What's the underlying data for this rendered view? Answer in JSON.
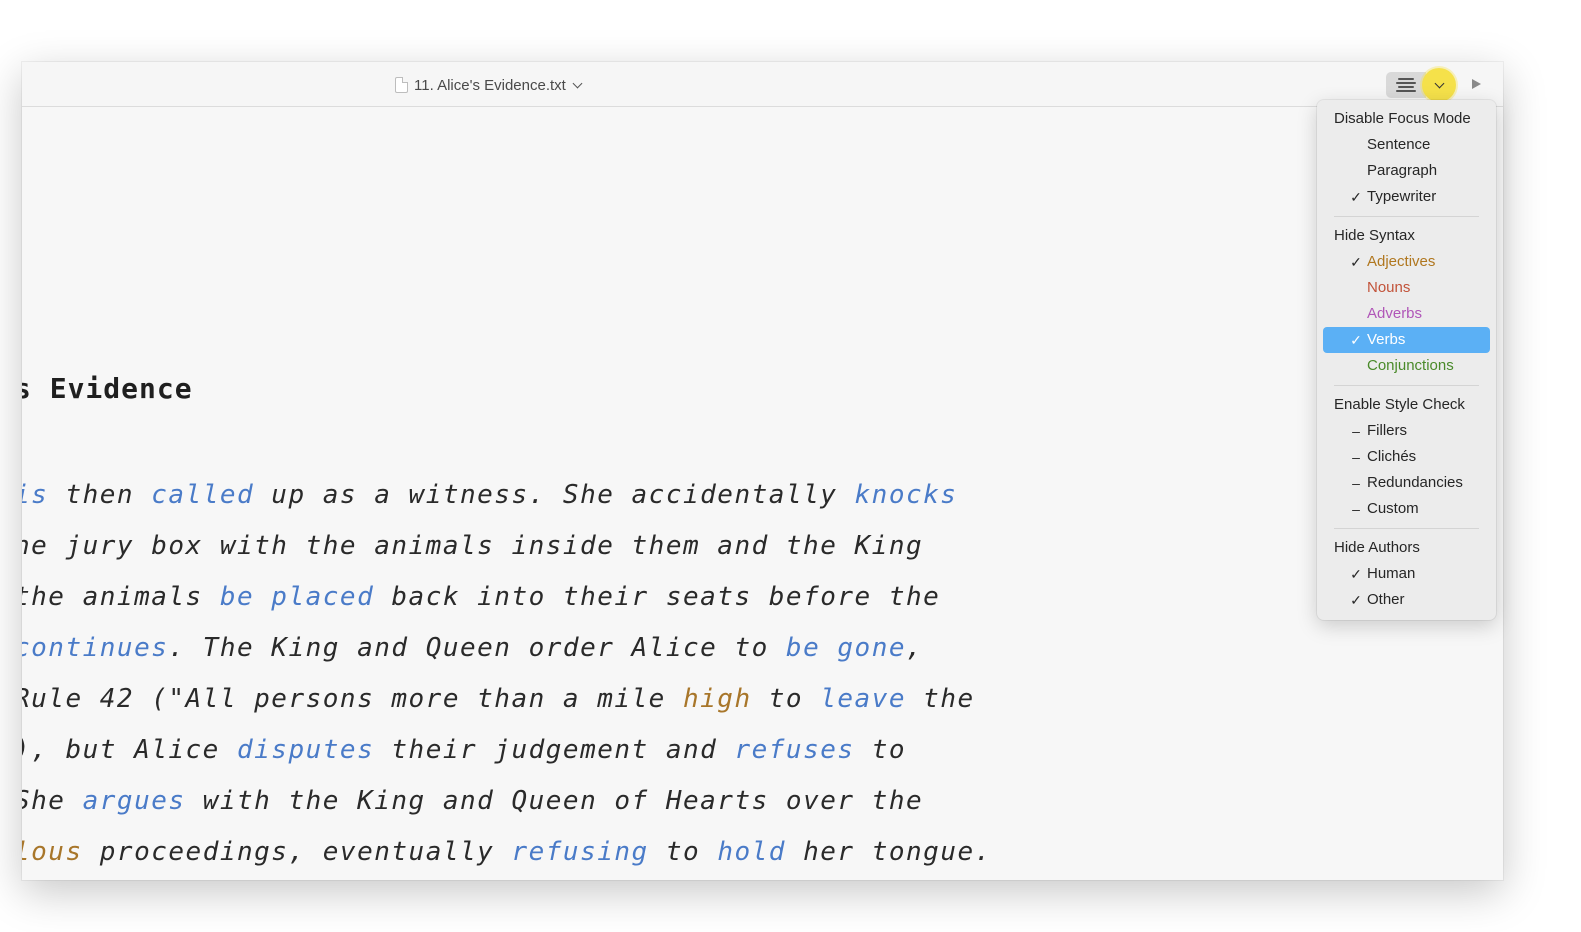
{
  "window": {
    "document_title": "11. Alice's Evidence.txt",
    "icons": {
      "document": "document-icon",
      "focus_mode": "focus-mode-lines-icon",
      "dropdown": "chevron-down-icon",
      "preview": "play-icon"
    },
    "highlight_color": "#f5e14a"
  },
  "editor": {
    "heading": "s Evidence",
    "lines": [
      [
        {
          "t": "is",
          "c": "verb"
        },
        {
          "t": " then "
        },
        {
          "t": "called",
          "c": "verb"
        },
        {
          "t": " up as a witness. She accidentally "
        },
        {
          "t": "knocks",
          "c": "verb"
        }
      ],
      [
        {
          "t": "he jury box with the animals inside them and the King"
        }
      ],
      [
        {
          "t": " the animals "
        },
        {
          "t": "be placed",
          "c": "verb"
        },
        {
          "t": " back into their seats before the"
        }
      ],
      [
        {
          "t": "continues",
          "c": "verb"
        },
        {
          "t": ". The King and Queen order Alice to "
        },
        {
          "t": "be gone",
          "c": "verb"
        },
        {
          "t": ","
        }
      ],
      [
        {
          "t": " Rule 42 (\"All persons more than a mile "
        },
        {
          "t": "high",
          "c": "adj"
        },
        {
          "t": " to "
        },
        {
          "t": "leave",
          "c": "verb"
        },
        {
          "t": " the"
        }
      ],
      [
        {
          "t": "), but Alice "
        },
        {
          "t": "disputes",
          "c": "verb"
        },
        {
          "t": " their judgement and "
        },
        {
          "t": "refuses",
          "c": "verb"
        },
        {
          "t": " to"
        }
      ],
      [
        {
          "t": " She "
        },
        {
          "t": "argues",
          "c": "verb"
        },
        {
          "t": " with the King and Queen of Hearts over the"
        }
      ],
      [
        {
          "t": "lous",
          "c": "adj"
        },
        {
          "t": " proceedings, eventually "
        },
        {
          "t": "refusing",
          "c": "verb"
        },
        {
          "t": " to "
        },
        {
          "t": "hold",
          "c": "verb"
        },
        {
          "t": " her tongue."
        }
      ]
    ],
    "colors": {
      "verb": "#4a7bc8",
      "adjective": "#a8762a"
    }
  },
  "menu": {
    "focus_header": "Disable Focus Mode",
    "sentence": "Sentence",
    "paragraph": "Paragraph",
    "typewriter": "Typewriter",
    "syntax_header": "Hide Syntax",
    "adjectives": "Adjectives",
    "nouns": "Nouns",
    "adverbs": "Adverbs",
    "verbs": "Verbs",
    "conjunctions": "Conjunctions",
    "style_header": "Enable Style Check",
    "fillers": "Fillers",
    "cliches": "Clichés",
    "redundancies": "Redundancies",
    "custom": "Custom",
    "authors_header": "Hide Authors",
    "human": "Human",
    "other": "Other",
    "check_mark": "✓",
    "dash_mark": "–",
    "checked": [
      "Typewriter",
      "Adjectives",
      "Verbs",
      "Human",
      "Other"
    ],
    "selected": "Verbs",
    "syntax_colors": {
      "adjectives": "#b0771f",
      "nouns": "#c2533a",
      "adverbs": "#b056b8",
      "conjunctions": "#4a8a2a"
    },
    "selection_color": "#5bb0f5"
  }
}
